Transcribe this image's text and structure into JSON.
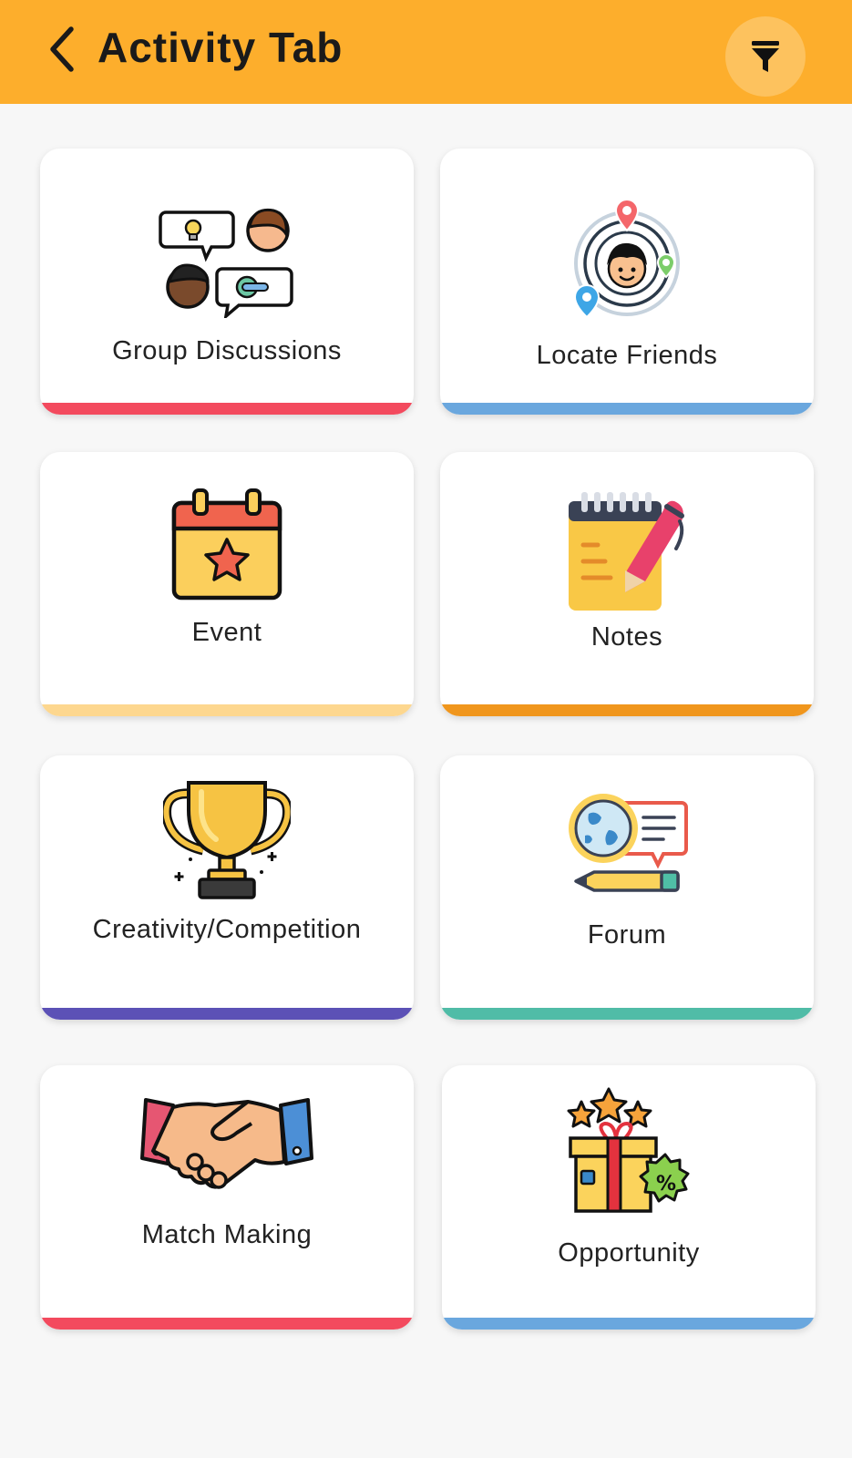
{
  "header": {
    "title": "Activity Tab",
    "back_icon": "chevron-left-icon",
    "filter_icon": "filter-icon",
    "color": "#fdae2c"
  },
  "cards": [
    {
      "label": "Group Discussions",
      "icon": "group-discussion-icon",
      "accent": "#f34a5e"
    },
    {
      "label": "Locate Friends",
      "icon": "locate-friends-icon",
      "accent": "#6aa7de"
    },
    {
      "label": "Event",
      "icon": "calendar-star-icon",
      "accent": "#fdd78f"
    },
    {
      "label": "Notes",
      "icon": "notepad-pen-icon",
      "accent": "#f0961d"
    },
    {
      "label": "Creativity/Competition",
      "icon": "trophy-icon",
      "accent": "#5c51b6"
    },
    {
      "label": "Forum",
      "icon": "globe-chat-icon",
      "accent": "#50bca7"
    },
    {
      "label": "Match Making",
      "icon": "handshake-icon",
      "accent": "#f34a5e"
    },
    {
      "label": "Opportunity",
      "icon": "gift-icon",
      "accent": "#6aa7de"
    }
  ]
}
